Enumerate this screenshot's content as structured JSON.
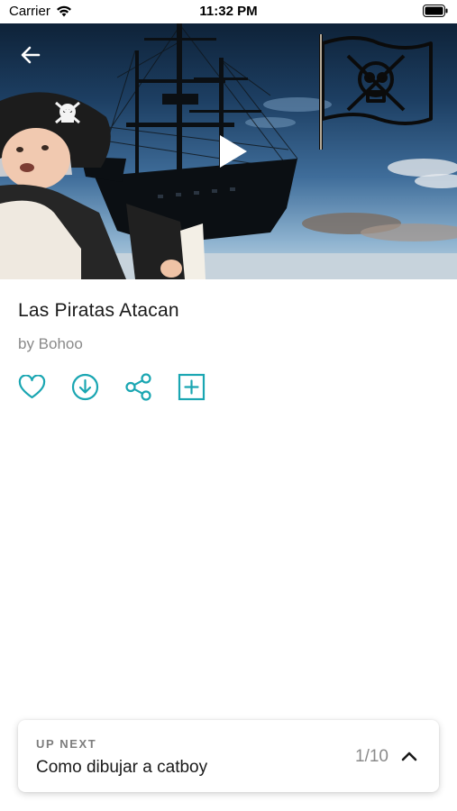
{
  "status_bar": {
    "carrier": "Carrier",
    "time": "11:32 PM",
    "wifi_icon": "wifi-icon",
    "battery_icon": "battery-icon"
  },
  "hero": {
    "back_icon": "back-arrow-icon",
    "play_icon": "play-icon",
    "flag_icon": "pirate-flag-icon"
  },
  "video": {
    "title": "Las Piratas Atacan",
    "author": "by Bohoo"
  },
  "actions": [
    {
      "name": "like",
      "icon": "heart-icon"
    },
    {
      "name": "download",
      "icon": "download-icon"
    },
    {
      "name": "share",
      "icon": "share-icon"
    },
    {
      "name": "add",
      "icon": "add-square-icon"
    }
  ],
  "up_next": {
    "label": "UP NEXT",
    "title": "Como dibujar a catboy",
    "count": "1/10",
    "chevron_icon": "chevron-up-icon"
  },
  "colors": {
    "accent": "#1aa6b2",
    "text": "#1a1a1a",
    "muted": "#8a8a8a"
  }
}
